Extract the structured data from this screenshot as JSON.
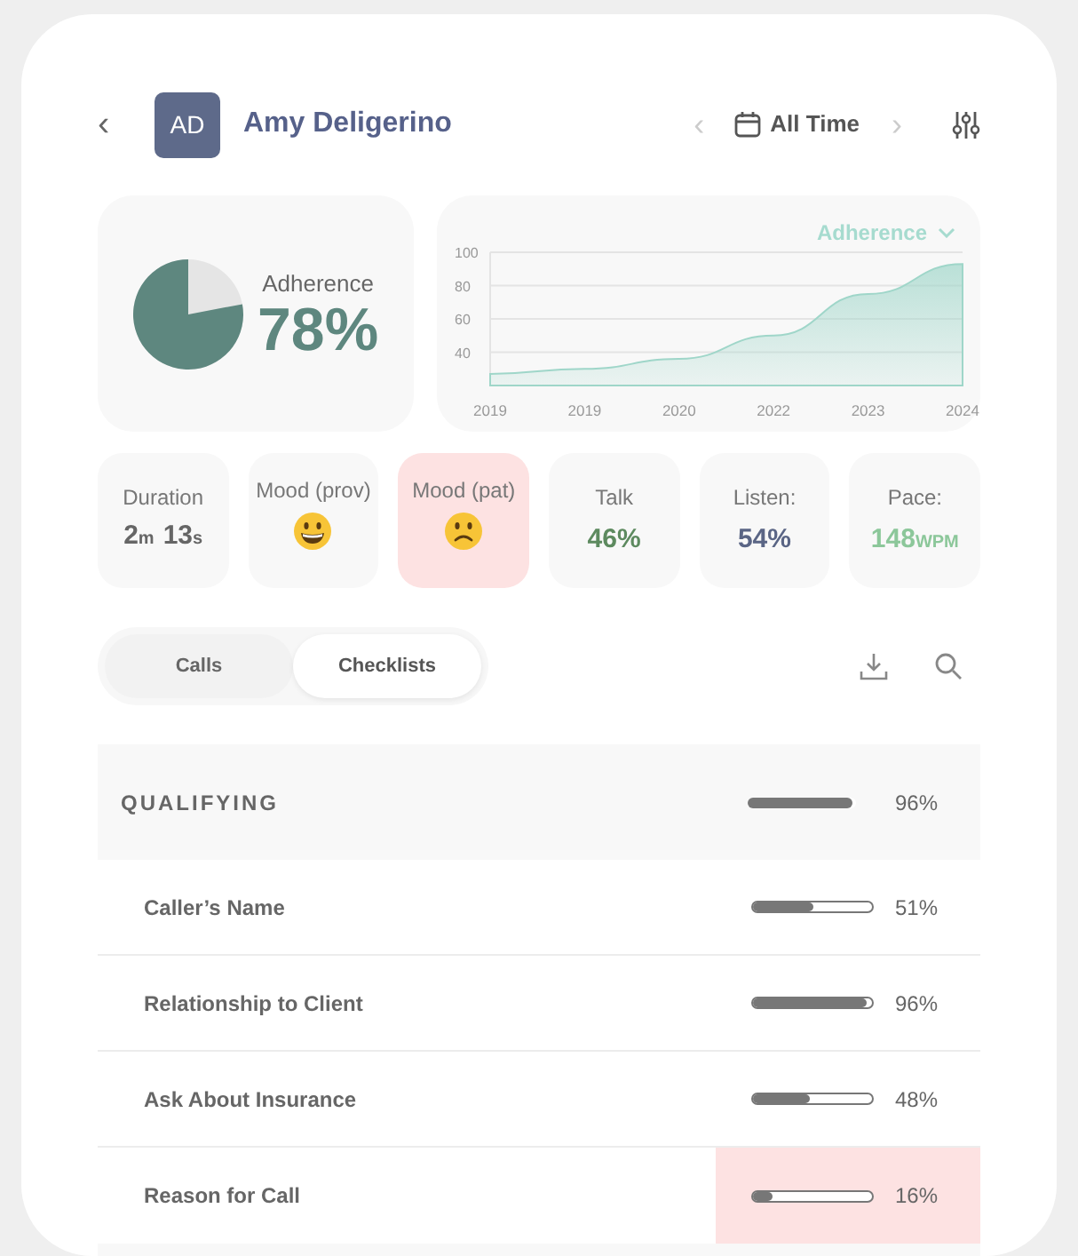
{
  "header": {
    "back": "‹",
    "initials": "AD",
    "name": "Amy Deligerino",
    "period": "All Time",
    "prev": "‹",
    "next": "›"
  },
  "adherence": {
    "label": "Adherence",
    "value": "78%"
  },
  "trend": {
    "chart_data": {
      "type": "area",
      "categories": [
        "2019",
        "2019",
        "2020",
        "2022",
        "2023",
        "2024"
      ],
      "series": [
        {
          "name": "Adherence",
          "color": "#9fd6c9",
          "values": [
            27,
            30,
            36,
            50,
            75,
            93
          ]
        }
      ],
      "ylim": [
        20,
        100
      ],
      "yticks": [
        40,
        60,
        80,
        100
      ],
      "grid": true
    }
  },
  "stats": [
    {
      "kind": "time",
      "label": "Duration",
      "parts": [
        {
          "num": "2",
          "unit": "m"
        },
        {
          "num": "13",
          "unit": "s"
        }
      ],
      "color": "#666666",
      "highlighted": false
    },
    {
      "kind": "happy",
      "label": "Mood (prov)",
      "highlighted": false
    },
    {
      "kind": "sad",
      "label": "Mood (pat)",
      "highlighted": true
    },
    {
      "kind": "value",
      "label": "Talk",
      "value": "46%",
      "color": "#5d8a5f",
      "highlighted": false
    },
    {
      "kind": "value",
      "label": "Listen:",
      "value": "54%",
      "color": "#5a6585",
      "highlighted": false
    },
    {
      "kind": "value",
      "label": "Pace:",
      "value": "148",
      "unit": "WPM",
      "color": "#8cc79a",
      "highlighted": false
    }
  ],
  "tabs": [
    {
      "label": "Calls",
      "selected": false
    },
    {
      "label": "Checklists",
      "selected": true
    }
  ],
  "checklist": {
    "section": {
      "title": "QUALIFYING",
      "level": 0.96,
      "value": "96%"
    },
    "items": [
      {
        "label": "Caller’s Name",
        "level": 0.51,
        "value": "51%",
        "flagged": false
      },
      {
        "label": "Relationship to Client",
        "level": 0.96,
        "value": "96%",
        "flagged": false
      },
      {
        "label": "Ask About Insurance",
        "level": 0.48,
        "value": "48%",
        "flagged": false
      },
      {
        "label": "Reason for Call",
        "level": 0.16,
        "value": "16%",
        "flagged": true
      }
    ]
  }
}
